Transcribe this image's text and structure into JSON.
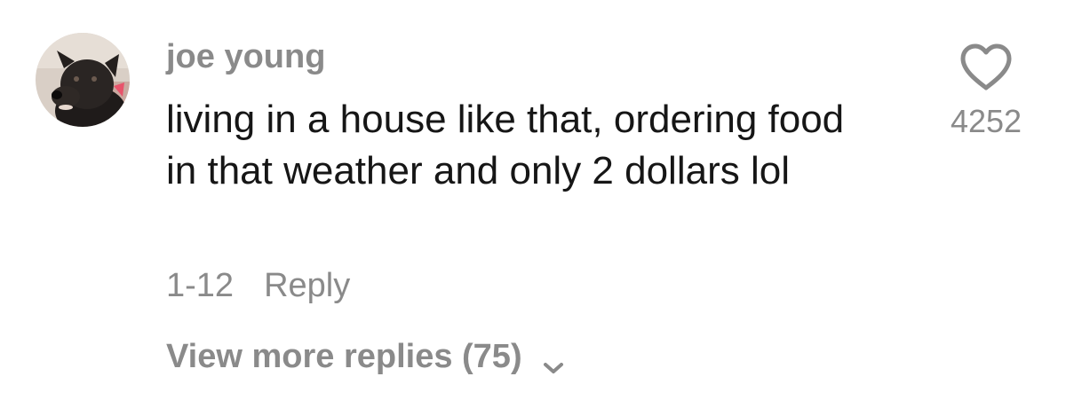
{
  "comment": {
    "username": "joe young",
    "text": "living in a house like that, ordering food in that weather and only 2 dollars lol",
    "date": "1-12",
    "reply_label": "Reply",
    "view_more_label": "View more replies (75)",
    "like_count": "4252",
    "avatar_icon": "dog-avatar",
    "like_icon": "heart-outline-icon",
    "expand_icon": "chevron-down-icon"
  },
  "colors": {
    "text_primary": "#161616",
    "text_secondary": "#8a8a8a",
    "background": "#ffffff"
  }
}
